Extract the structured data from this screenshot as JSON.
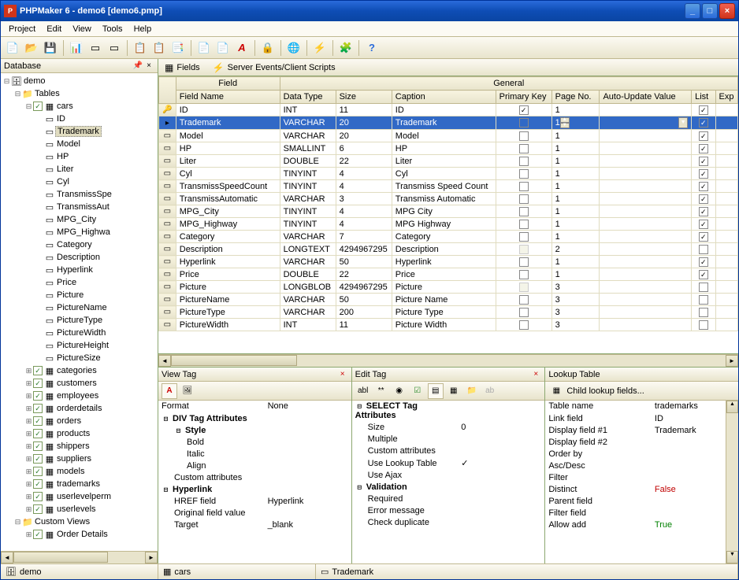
{
  "window": {
    "title": "PHPMaker 6 - demo6 [demo6.pmp]"
  },
  "menubar": [
    "Project",
    "Edit",
    "View",
    "Tools",
    "Help"
  ],
  "sidebar": {
    "title": "Database",
    "root": "demo",
    "tables_label": "Tables",
    "selected_table": "cars",
    "fields": [
      "ID",
      "Trademark",
      "Model",
      "HP",
      "Liter",
      "Cyl",
      "TransmissSpe",
      "TransmissAut",
      "MPG_City",
      "MPG_Highwa",
      "Category",
      "Description",
      "Hyperlink",
      "Price",
      "Picture",
      "PictureName",
      "PictureType",
      "PictureWidth",
      "PictureHeight",
      "PictureSize"
    ],
    "selected_field": "Trademark",
    "other_tables": [
      "categories",
      "customers",
      "employees",
      "orderdetails",
      "orders",
      "products",
      "shippers",
      "suppliers",
      "models",
      "trademarks",
      "userlevelperm",
      "userlevels"
    ],
    "custom_views_label": "Custom Views",
    "custom_views": [
      "Order Details"
    ]
  },
  "tabs": {
    "fields": "Fields",
    "events": "Server Events/Client Scripts"
  },
  "grid": {
    "group_field": "Field",
    "group_general": "General",
    "cols": {
      "name": "Field Name",
      "type": "Data Type",
      "size": "Size",
      "caption": "Caption",
      "pkey": "Primary Key",
      "page": "Page No.",
      "auto": "Auto-Update Value",
      "list": "List",
      "exp": "Exp"
    },
    "rows": [
      {
        "name": "ID",
        "type": "INT",
        "size": "11",
        "caption": "ID",
        "pkey": true,
        "page": "1",
        "list": true,
        "key": true
      },
      {
        "name": "Trademark",
        "type": "VARCHAR",
        "size": "20",
        "caption": "Trademark",
        "pkey": false,
        "page": "1",
        "list": true,
        "sel": true
      },
      {
        "name": "Model",
        "type": "VARCHAR",
        "size": "20",
        "caption": "Model",
        "pkey": false,
        "page": "1",
        "list": true
      },
      {
        "name": "HP",
        "type": "SMALLINT",
        "size": "6",
        "caption": "HP",
        "pkey": false,
        "page": "1",
        "list": true
      },
      {
        "name": "Liter",
        "type": "DOUBLE",
        "size": "22",
        "caption": "Liter",
        "pkey": false,
        "page": "1",
        "list": true
      },
      {
        "name": "Cyl",
        "type": "TINYINT",
        "size": "4",
        "caption": "Cyl",
        "pkey": false,
        "page": "1",
        "list": true
      },
      {
        "name": "TransmissSpeedCount",
        "type": "TINYINT",
        "size": "4",
        "caption": "Transmiss Speed Count",
        "pkey": false,
        "page": "1",
        "list": true
      },
      {
        "name": "TransmissAutomatic",
        "type": "VARCHAR",
        "size": "3",
        "caption": "Transmiss Automatic",
        "pkey": false,
        "page": "1",
        "list": true
      },
      {
        "name": "MPG_City",
        "type": "TINYINT",
        "size": "4",
        "caption": "MPG City",
        "pkey": false,
        "page": "1",
        "list": true
      },
      {
        "name": "MPG_Highway",
        "type": "TINYINT",
        "size": "4",
        "caption": "MPG Highway",
        "pkey": false,
        "page": "1",
        "list": true
      },
      {
        "name": "Category",
        "type": "VARCHAR",
        "size": "7",
        "caption": "Category",
        "pkey": false,
        "page": "1",
        "list": true
      },
      {
        "name": "Description",
        "type": "LONGTEXT",
        "size": "4294967295",
        "caption": "Description",
        "pkey": false,
        "page": "2",
        "list": false,
        "dim": true
      },
      {
        "name": "Hyperlink",
        "type": "VARCHAR",
        "size": "50",
        "caption": "Hyperlink",
        "pkey": false,
        "page": "1",
        "list": true
      },
      {
        "name": "Price",
        "type": "DOUBLE",
        "size": "22",
        "caption": "Price",
        "pkey": false,
        "page": "1",
        "list": true
      },
      {
        "name": "Picture",
        "type": "LONGBLOB",
        "size": "4294967295",
        "caption": "Picture",
        "pkey": false,
        "page": "3",
        "list": false,
        "dim": true
      },
      {
        "name": "PictureName",
        "type": "VARCHAR",
        "size": "50",
        "caption": "Picture Name",
        "pkey": false,
        "page": "3",
        "list": false
      },
      {
        "name": "PictureType",
        "type": "VARCHAR",
        "size": "200",
        "caption": "Picture Type",
        "pkey": false,
        "page": "3",
        "list": false
      },
      {
        "name": "PictureWidth",
        "type": "INT",
        "size": "11",
        "caption": "Picture Width",
        "pkey": false,
        "page": "3",
        "list": false
      }
    ]
  },
  "view_tag": {
    "title": "View Tag",
    "rows": [
      {
        "k": "Format",
        "v": "None",
        "ind": 0
      },
      {
        "k": "DIV Tag Attributes",
        "grp": true
      },
      {
        "k": "Style",
        "grp": true,
        "ind": 1
      },
      {
        "k": "Bold",
        "v": "",
        "chk": true,
        "ind": 2
      },
      {
        "k": "Italic",
        "v": "",
        "chk": true,
        "ind": 2
      },
      {
        "k": "Align",
        "v": "",
        "ind": 2
      },
      {
        "k": "Custom attributes",
        "v": "",
        "ind": 1
      },
      {
        "k": "Hyperlink",
        "grp": true
      },
      {
        "k": "HREF field",
        "v": "Hyperlink",
        "ind": 1
      },
      {
        "k": "Original field value",
        "v": "",
        "chk": true,
        "ind": 1
      },
      {
        "k": "Target",
        "v": "_blank",
        "ind": 1
      }
    ]
  },
  "edit_tag": {
    "title": "Edit Tag",
    "rows": [
      {
        "k": "SELECT Tag Attributes",
        "grp": true
      },
      {
        "k": "Size",
        "v": "0",
        "ind": 1
      },
      {
        "k": "Multiple",
        "v": "",
        "chk": true,
        "ind": 1
      },
      {
        "k": "Custom attributes",
        "v": "",
        "ind": 1
      },
      {
        "k": "Use Lookup Table",
        "v": "",
        "chk": true,
        "chkval": true,
        "ind": 1
      },
      {
        "k": "Use Ajax",
        "v": "",
        "chk": true,
        "ind": 1
      },
      {
        "k": "Validation",
        "grp": true
      },
      {
        "k": "Required",
        "v": "",
        "chk": true,
        "ind": 1
      },
      {
        "k": "Error message",
        "v": "",
        "ind": 1
      },
      {
        "k": "Check duplicate",
        "v": "",
        "chk": true,
        "ind": 1
      }
    ]
  },
  "lookup": {
    "title": "Lookup Table",
    "child_label": "Child lookup fields...",
    "rows": [
      {
        "k": "Table name",
        "v": "trademarks"
      },
      {
        "k": "Link field",
        "v": "ID"
      },
      {
        "k": "Display field #1",
        "v": "Trademark"
      },
      {
        "k": "Display field #2",
        "v": ""
      },
      {
        "k": "Order by",
        "v": ""
      },
      {
        "k": "Asc/Desc",
        "v": ""
      },
      {
        "k": "Filter",
        "v": ""
      },
      {
        "k": "Distinct",
        "v": "False",
        "cls": "red"
      },
      {
        "k": "Parent field",
        "v": ""
      },
      {
        "k": "Filter field",
        "v": ""
      },
      {
        "k": "Allow add",
        "v": "True",
        "cls": "green"
      }
    ]
  },
  "statusbar": {
    "db": "demo",
    "table": "cars",
    "field": "Trademark"
  }
}
